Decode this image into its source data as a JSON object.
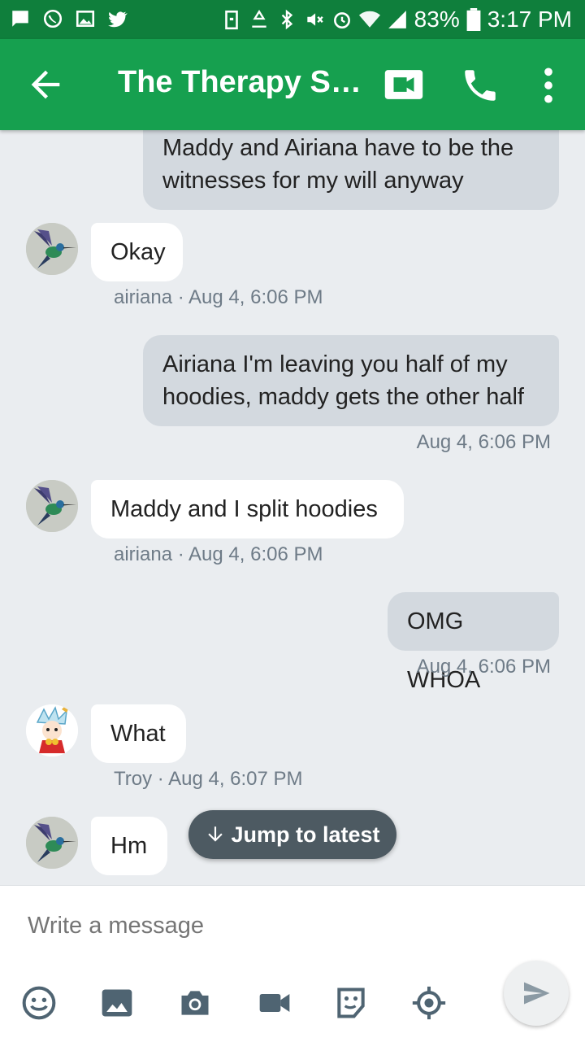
{
  "status_bar": {
    "battery_percent": "83%",
    "time": "3:17 PM",
    "left_icons": [
      "message-icon",
      "whatsapp-icon",
      "gallery-icon",
      "twitter-icon"
    ],
    "right_icons": [
      "battery-saver-icon",
      "recycle-icon",
      "bluetooth-icon",
      "mute-icon",
      "alarm-icon",
      "wifi-icon",
      "signal-icon",
      "battery-icon"
    ]
  },
  "app_bar": {
    "title": "The Therapy Se...",
    "icons": [
      "back-arrow-icon",
      "video-call-icon",
      "phone-icon",
      "more-vert-icon"
    ],
    "color": "#16a04f"
  },
  "messages": [
    {
      "type": "outgoing",
      "lines": [
        "Maddy and Airiana have to be the",
        "witnesses for my will anyway"
      ]
    },
    {
      "type": "incoming",
      "text": "Okay",
      "meta": "airiana · Aug 4, 6:06 PM",
      "avatar": "hummingbird-avatar"
    },
    {
      "type": "outgoing",
      "lines": [
        "Airiana I'm leaving you half of my",
        "hoodies, maddy gets the other half"
      ],
      "meta": "Aug 4, 6:06 PM"
    },
    {
      "type": "incoming",
      "text": "Maddy and I split hoodies",
      "meta": "airiana · Aug 4, 6:06 PM",
      "avatar": "hummingbird-avatar"
    },
    {
      "type": "outgoing",
      "text": "OMG WHOA",
      "meta": "Aug 4, 6:06 PM"
    },
    {
      "type": "incoming",
      "text": "What",
      "meta": "Troy · Aug 4, 6:07 PM",
      "avatar": "cartoon-avatar"
    },
    {
      "type": "incoming",
      "text": "Hm",
      "avatar": "hummingbird-avatar"
    }
  ],
  "jump_button": {
    "label": "Jump to latest",
    "icon": "arrow-down-icon"
  },
  "composer": {
    "placeholder": "Write a message",
    "tools": [
      "emoji-icon",
      "image-icon",
      "camera-icon",
      "video-icon",
      "sticker-icon",
      "location-icon"
    ],
    "send_icon": "send-icon"
  }
}
